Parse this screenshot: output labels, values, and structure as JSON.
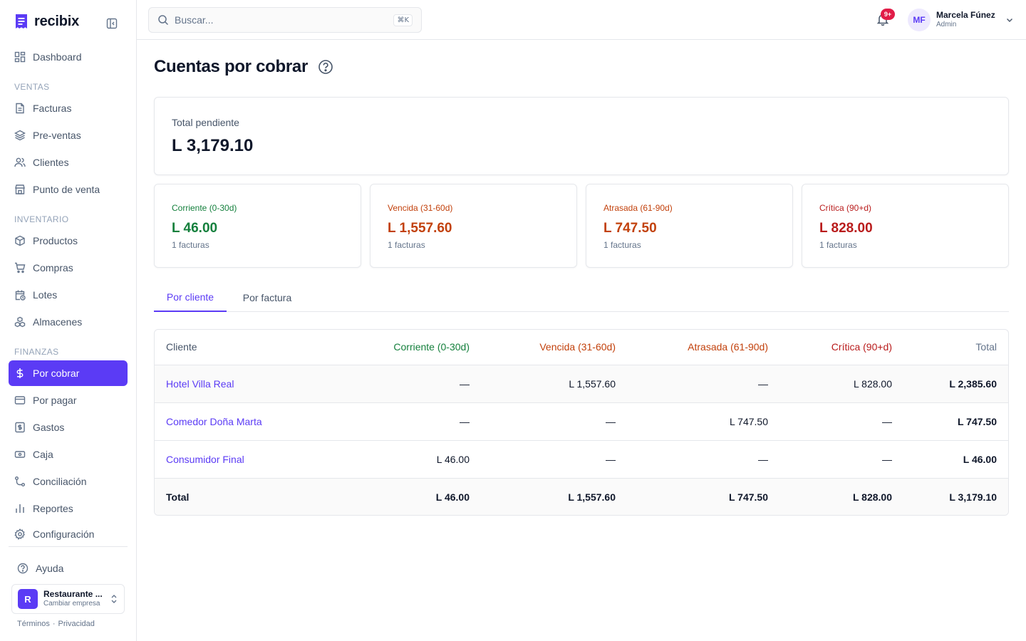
{
  "brand": {
    "name": "recibix"
  },
  "colors": {
    "accent": "#5b3bf5",
    "corriente": "#15803d",
    "vencida": "#c2410c",
    "atrasada": "#c2410c",
    "critica": "#b91c1c",
    "notification": "#e11d48"
  },
  "sidebar": {
    "dashboard": "Dashboard",
    "sections": {
      "ventas": "VENTAS",
      "inventario": "INVENTARIO",
      "finanzas": "FINANZAS"
    },
    "items": {
      "facturas": "Facturas",
      "preventas": "Pre-ventas",
      "clientes": "Clientes",
      "punto_venta": "Punto de venta",
      "productos": "Productos",
      "compras": "Compras",
      "lotes": "Lotes",
      "almacenes": "Almacenes",
      "por_cobrar": "Por cobrar",
      "por_pagar": "Por pagar",
      "gastos": "Gastos",
      "caja": "Caja",
      "conciliacion": "Conciliación",
      "reportes": "Reportes",
      "configuracion": "Configuración"
    },
    "active": "por_cobrar",
    "help": "Ayuda",
    "company": {
      "initial": "R",
      "name": "Restaurante ...",
      "action": "Cambiar empresa"
    },
    "legal": {
      "terms": "Términos",
      "separator": "·",
      "privacy": "Privacidad"
    }
  },
  "header": {
    "search_placeholder": "Buscar...",
    "search_shortcut": "⌘K",
    "notifications_badge": "9+",
    "user": {
      "initials": "MF",
      "name": "Marcela Fúnez",
      "role": "Admin"
    }
  },
  "page": {
    "title": "Cuentas por cobrar",
    "total": {
      "label": "Total pendiente",
      "value": "L 3,179.10"
    },
    "buckets": [
      {
        "label": "Corriente (0-30d)",
        "value": "L 46.00",
        "count": "1 facturas"
      },
      {
        "label": "Vencida (31-60d)",
        "value": "L 1,557.60",
        "count": "1 facturas"
      },
      {
        "label": "Atrasada (61-90d)",
        "value": "L 747.50",
        "count": "1 facturas"
      },
      {
        "label": "Crítica (90+d)",
        "value": "L 828.00",
        "count": "1 facturas"
      }
    ],
    "tabs": [
      "Por cliente",
      "Por factura"
    ],
    "active_tab": 0
  },
  "table": {
    "headers": [
      "Cliente",
      "Corriente (0-30d)",
      "Vencida (31-60d)",
      "Atrasada (61-90d)",
      "Crítica (90+d)",
      "Total"
    ],
    "rows": [
      [
        "Hotel Villa Real",
        "—",
        "L 1,557.60",
        "—",
        "L 828.00",
        "L 2,385.60"
      ],
      [
        "Comedor Doña Marta",
        "—",
        "—",
        "L 747.50",
        "—",
        "L 747.50"
      ],
      [
        "Consumidor Final",
        "L 46.00",
        "—",
        "—",
        "—",
        "L 46.00"
      ]
    ],
    "footer": [
      "Total",
      "L 46.00",
      "L 1,557.60",
      "L 747.50",
      "L 828.00",
      "L 3,179.10"
    ]
  }
}
